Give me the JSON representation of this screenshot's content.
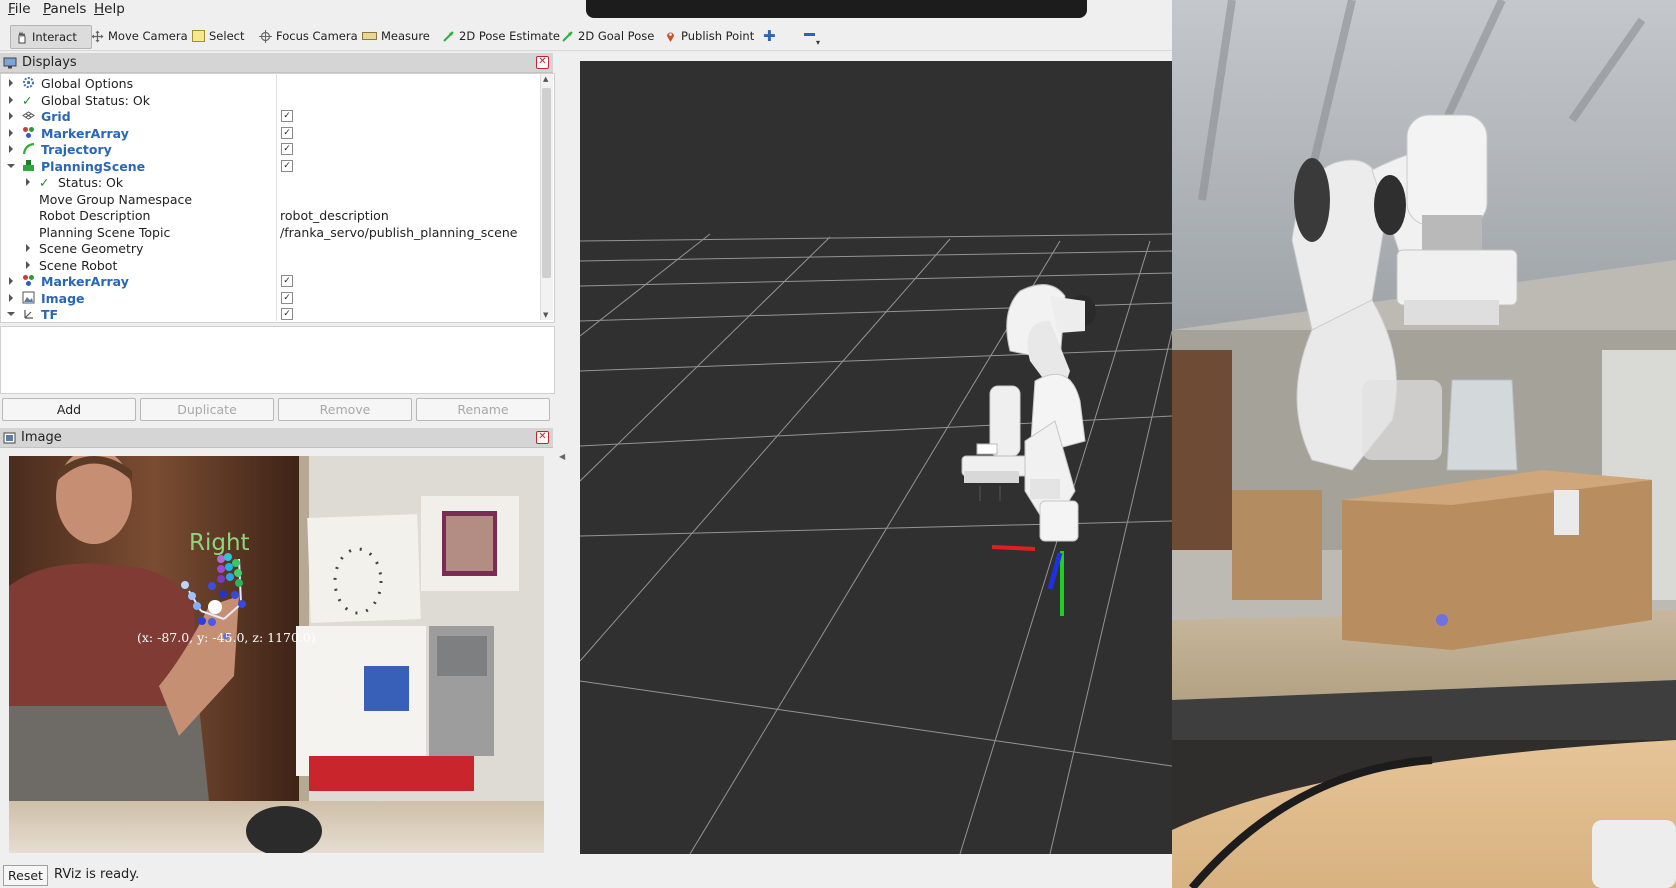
{
  "menubar": {
    "items": [
      {
        "label": "File",
        "underline": "F",
        "rest": "ile"
      },
      {
        "label": "Panels",
        "underline": "P",
        "rest": "anels"
      },
      {
        "label": "Help",
        "underline": "H",
        "rest": "elp"
      }
    ]
  },
  "toolbar": {
    "interact": "Interact",
    "move_camera": "Move Camera",
    "select": "Select",
    "focus_camera": "Focus Camera",
    "measure": "Measure",
    "pose_estimate": "2D Pose Estimate",
    "goal_pose": "2D Goal Pose",
    "publish_point": "Publish Point"
  },
  "displays_panel": {
    "title": "Displays",
    "rows": [
      {
        "label": "Global Options",
        "icon": "gear-icon"
      },
      {
        "label": "Global Status: Ok",
        "icon": "check-icon"
      },
      {
        "label": "Grid",
        "icon": "grid-icon",
        "checked": true
      },
      {
        "label": "MarkerArray",
        "icon": "marker-array-icon",
        "checked": true
      },
      {
        "label": "Trajectory",
        "icon": "trajectory-icon",
        "checked": true
      },
      {
        "label": "PlanningScene",
        "icon": "planning-scene-icon",
        "checked": true,
        "expanded": true
      },
      {
        "label": "Status: Ok",
        "icon": "check-icon"
      },
      {
        "label": "Move Group Namespace",
        "value": ""
      },
      {
        "label": "Robot Description",
        "value": "robot_description"
      },
      {
        "label": "Planning Scene Topic",
        "value": "/franka_servo/publish_planning_scene"
      },
      {
        "label": "Scene Geometry"
      },
      {
        "label": "Scene Robot"
      },
      {
        "label": "MarkerArray",
        "icon": "marker-array-icon",
        "checked": true
      },
      {
        "label": "Image",
        "icon": "image-icon",
        "checked": true
      },
      {
        "label": "TF",
        "icon": "tf-icon",
        "checked": true
      }
    ],
    "buttons": {
      "add": "Add",
      "duplicate": "Duplicate",
      "remove": "Remove",
      "rename": "Rename"
    }
  },
  "image_panel": {
    "title": "Image",
    "hand_label": "Right",
    "coords_text": "(x: -87.0, y: -45.0, z: 1170.0)"
  },
  "statusbar": {
    "reset": "Reset",
    "message": "RViz is ready."
  },
  "colors": {
    "accent_blue": "#2a66b8",
    "view_bg": "#303030",
    "close_red": "#c0262c"
  }
}
